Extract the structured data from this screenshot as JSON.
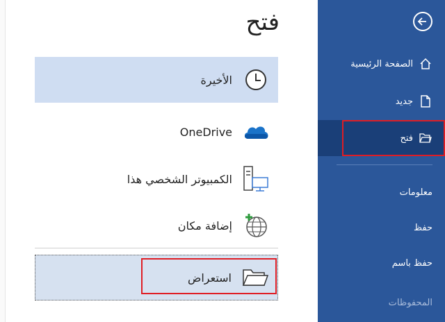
{
  "sidebar": {
    "items": [
      {
        "label": "الصفحة الرئيسية",
        "icon": "home-icon"
      },
      {
        "label": "جديد",
        "icon": "new-document-icon"
      },
      {
        "label": "فتح",
        "icon": "open-folder-icon",
        "active": true
      },
      {
        "label": "معلومات"
      },
      {
        "label": "حفظ"
      },
      {
        "label": "حفظ باسم"
      },
      {
        "label": "المحفوظات",
        "muted": true
      }
    ],
    "back_icon": "back-arrow-icon",
    "colors": {
      "background": "#2b579a",
      "active": "#1a3f78",
      "highlight": "#e01d24"
    }
  },
  "main": {
    "title": "فتح",
    "locations": [
      {
        "label": "الأخيرة",
        "icon": "clock-icon",
        "selected": true
      },
      {
        "label": "OneDrive",
        "icon": "cloud-icon"
      },
      {
        "label": "الكمبيوتر الشخصي هذا",
        "icon": "computer-icon"
      },
      {
        "label": "إضافة مكان",
        "icon": "add-place-globe-icon"
      },
      {
        "label": "استعراض",
        "icon": "folder-icon"
      }
    ]
  }
}
